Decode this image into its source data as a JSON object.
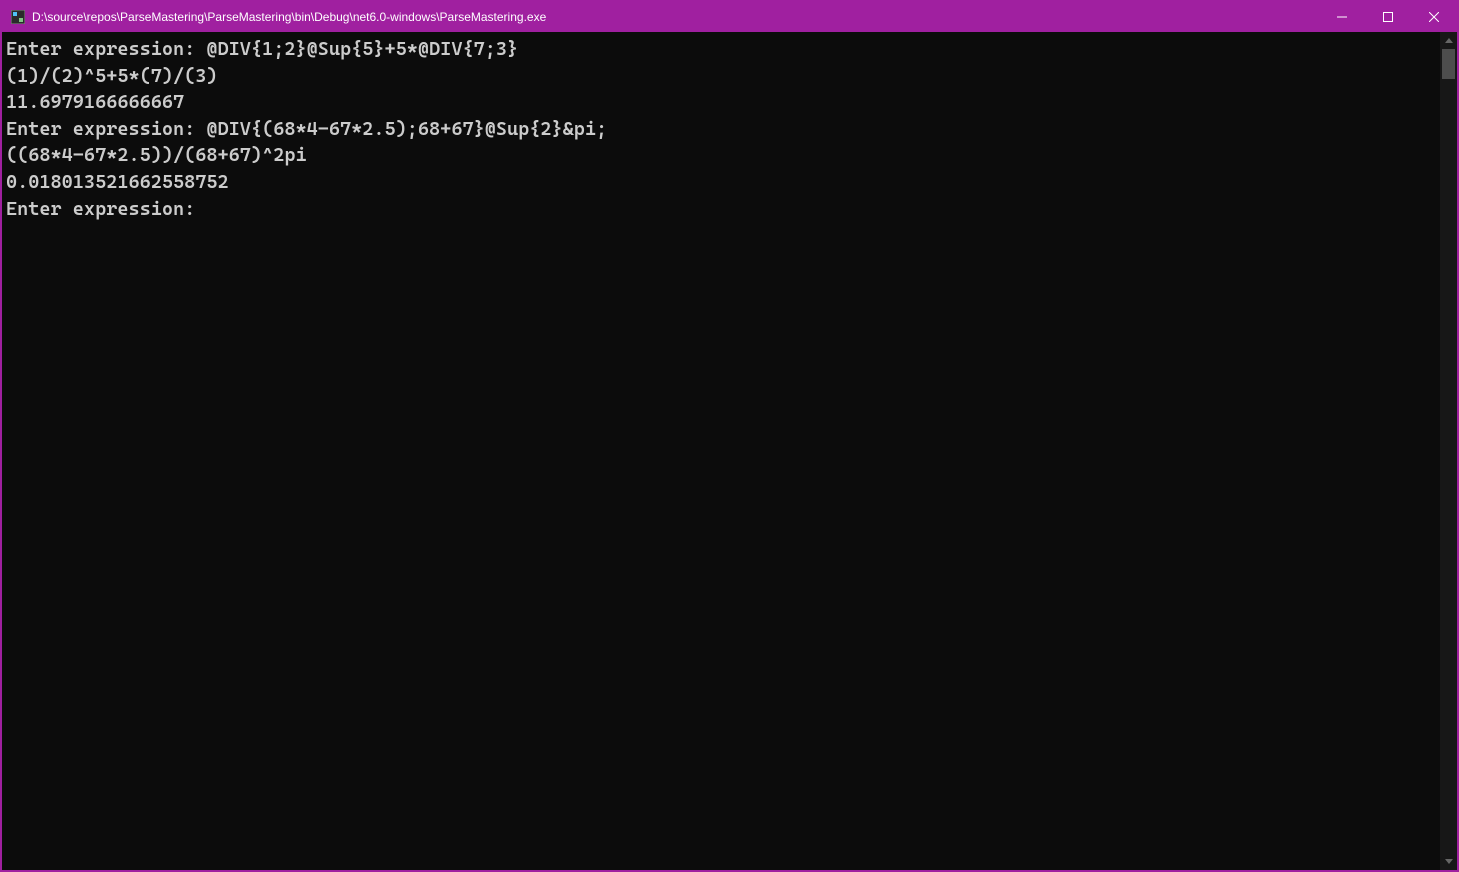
{
  "window": {
    "title": "D:\\source\\repos\\ParseMastering\\ParseMastering\\bin\\Debug\\net6.0-windows\\ParseMastering.exe"
  },
  "console": {
    "lines": [
      "Enter expression: @DIV{1;2}@Sup{5}+5*@DIV{7;3}",
      "(1)/(2)^5+5*(7)/(3)",
      "11.6979166666667",
      "Enter expression: @DIV{(68*4-67*2.5);68+67}@Sup{2}&pi;",
      "((68*4-67*2.5))/(68+67)^2pi",
      "0.018013521662558752",
      "Enter expression: "
    ]
  },
  "colors": {
    "titlebar": "#a020a0",
    "console_bg": "#0c0c0c",
    "console_fg": "#cccccc"
  }
}
